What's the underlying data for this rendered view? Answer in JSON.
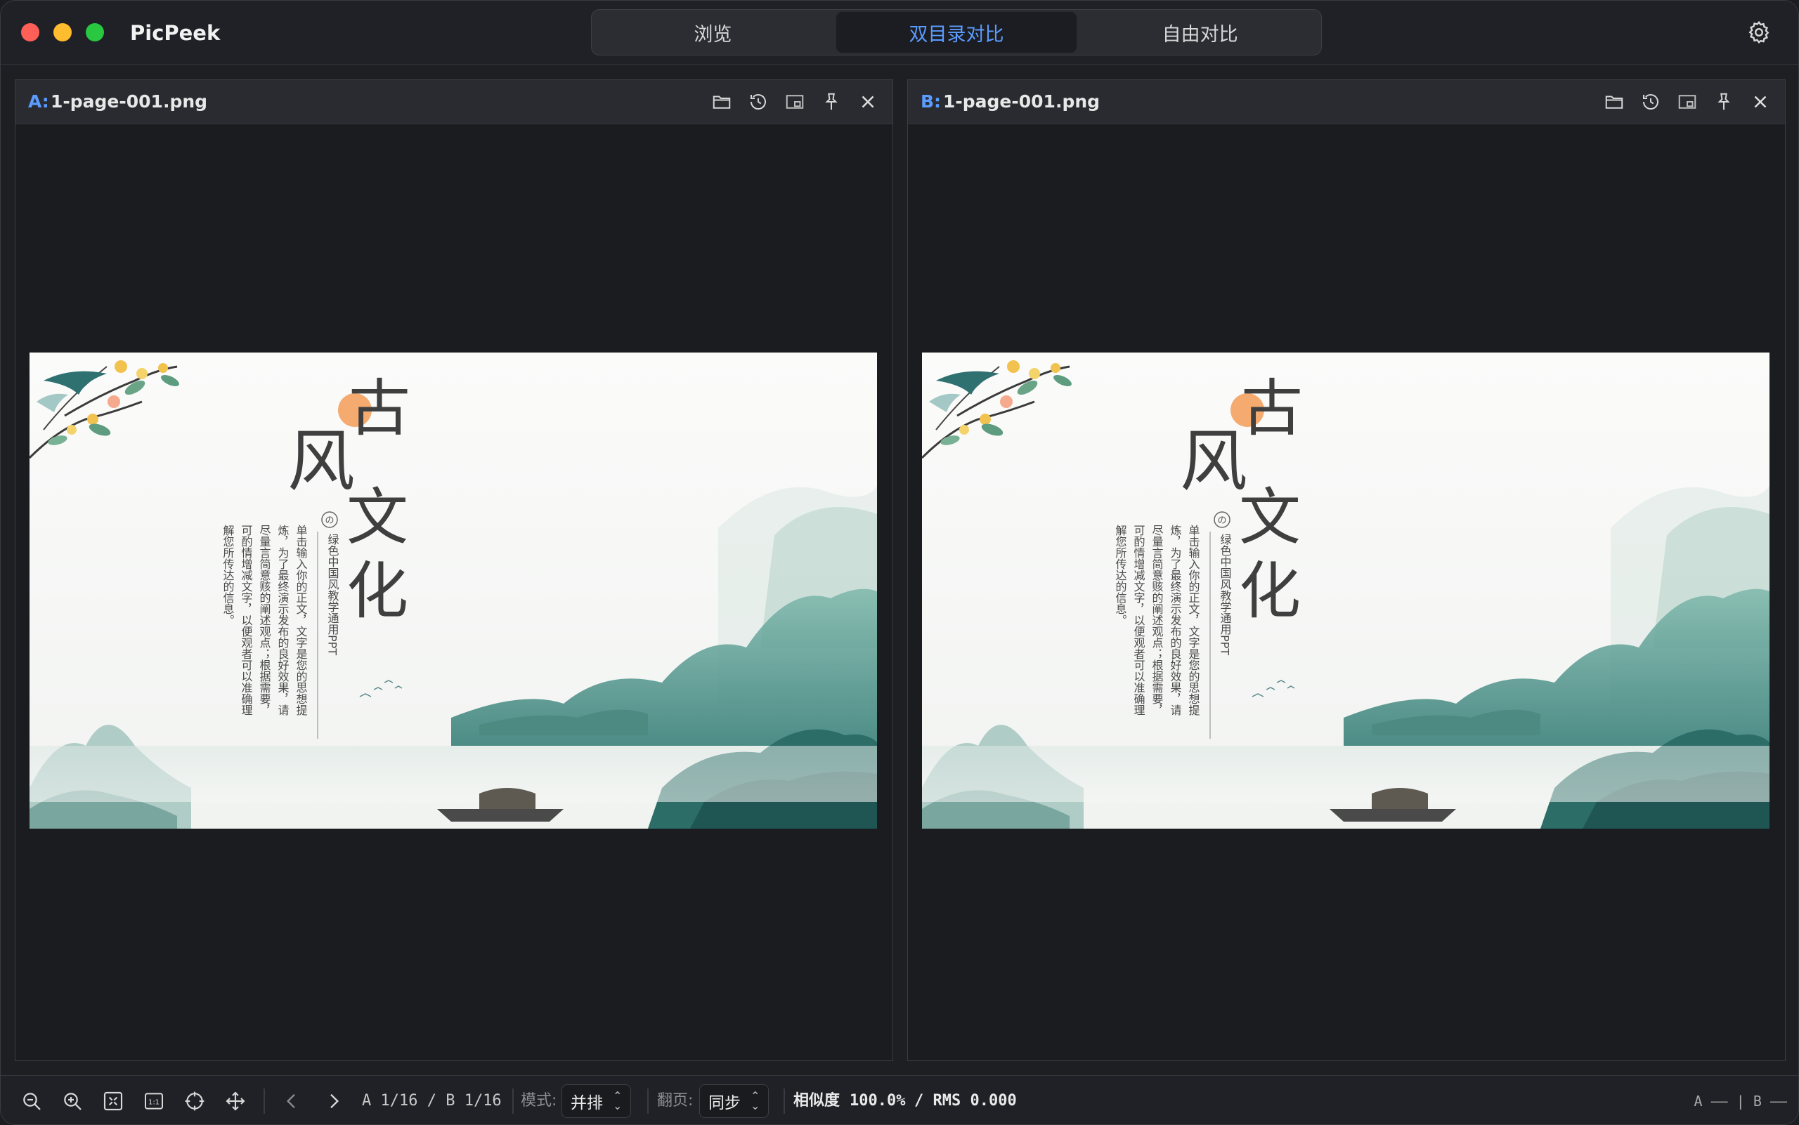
{
  "app": {
    "title": "PicPeek"
  },
  "tabs": [
    {
      "label": "浏览",
      "active": false
    },
    {
      "label": "双目录对比",
      "active": true
    },
    {
      "label": "自由对比",
      "active": false
    }
  ],
  "panes": {
    "a": {
      "label": "A:",
      "file": "1-page-001.png"
    },
    "b": {
      "label": "B:",
      "file": "1-page-001.png"
    }
  },
  "slide": {
    "title_chars": [
      "古",
      "风",
      "文",
      "化"
    ],
    "badge": "の",
    "subtitle": "绿色中国风教学通用PPT",
    "body_lines": [
      "单击输入你的正文，文字是您的思想提",
      "炼，为了最终演示发布的良好效果，请",
      "尽量言简意赅的阐述观点；根据需要，",
      "可酌情增减文字，以便观者可以准确理",
      "解您所传达的信息。"
    ]
  },
  "toolbar": {
    "page_status": "A 1/16 / B 1/16",
    "mode_label": "模式:",
    "mode_value": "并排",
    "paging_label": "翻页:",
    "paging_value": "同步",
    "similarity_label": "相似度",
    "similarity_value": "100.0%",
    "rms_text": "/ RMS 0.000",
    "status_right": "A –– | B ––"
  },
  "icons": {
    "pane_tools": [
      "folder-icon",
      "history-icon",
      "fit-window-icon",
      "pin-icon",
      "close-icon"
    ],
    "bottom_tools": [
      "zoom-out-icon",
      "zoom-in-icon",
      "fit-screen-icon",
      "actual-size-icon",
      "crosshair-icon",
      "move-icon",
      "chevron-left-icon",
      "chevron-right-icon"
    ],
    "settings": "gear-icon"
  },
  "colors": {
    "accent": "#5a9cff",
    "window_bg": "#1e1f23"
  }
}
